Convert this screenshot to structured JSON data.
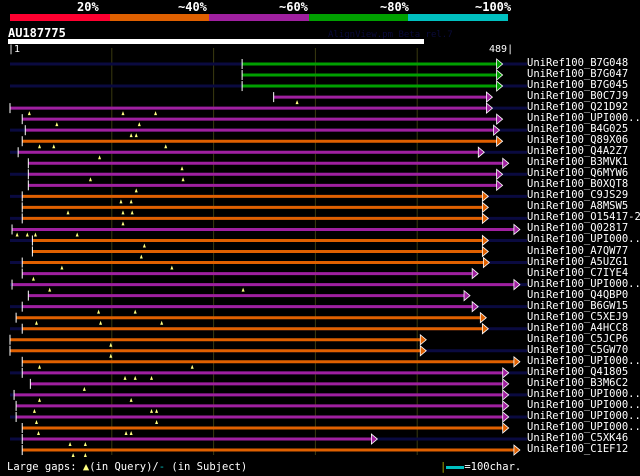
{
  "legend": {
    "labels": [
      "20%",
      "~40%",
      "~60%",
      "~80%",
      "~100%"
    ],
    "colors": [
      "#ff0030",
      "#e06000",
      "#a020a0",
      "#00a000",
      "#00c0c0"
    ]
  },
  "query": {
    "name": "AU187775",
    "start": "1",
    "end": "489",
    "length": 489
  },
  "credit": "AlignView.pm Beta rel.7",
  "hits": [
    {
      "name": "UniRef100_B7G048",
      "c": 3,
      "s": 229,
      "e": 479,
      "g": []
    },
    {
      "name": "UniRef100_B7G047",
      "c": 3,
      "s": 229,
      "e": 479,
      "g": []
    },
    {
      "name": "UniRef100_B7G045",
      "c": 3,
      "s": 229,
      "e": 479,
      "g": []
    },
    {
      "name": "UniRef100_B0C7J9",
      "c": 2,
      "s": 260,
      "e": 469,
      "g": [
        283
      ]
    },
    {
      "name": "UniRef100_Q21D92",
      "c": 2,
      "s": 1,
      "e": 469,
      "g": [
        20,
        112,
        144
      ]
    },
    {
      "name": "UniRef100_UPI000..",
      "c": 2,
      "s": 13,
      "e": 479,
      "g": [
        47,
        128
      ]
    },
    {
      "name": "UniRef100_B4G025",
      "c": 2,
      "s": 16,
      "e": 476,
      "g": [
        120,
        125
      ]
    },
    {
      "name": "UniRef100_Q89X06",
      "c": 1,
      "s": 13,
      "e": 479,
      "g": [
        30,
        44,
        154
      ]
    },
    {
      "name": "UniRef100_Q4A2Z7",
      "c": 2,
      "s": 9,
      "e": 461,
      "g": [
        89
      ]
    },
    {
      "name": "UniRef100_B3MVK1",
      "c": 2,
      "s": 19,
      "e": 485,
      "g": [
        170
      ]
    },
    {
      "name": "UniRef100_Q6MYW6",
      "c": 2,
      "s": 19,
      "e": 479,
      "g": [
        80,
        171
      ]
    },
    {
      "name": "UniRef100_B0XQT8",
      "c": 2,
      "s": 19,
      "e": 479,
      "g": [
        125
      ]
    },
    {
      "name": "UniRef100_C9JS29",
      "c": 1,
      "s": 13,
      "e": 465,
      "g": [
        110,
        120
      ]
    },
    {
      "name": "UniRef100_A8MSW5",
      "c": 1,
      "s": 13,
      "e": 465,
      "g": [
        58,
        112,
        121
      ]
    },
    {
      "name": "UniRef100_O15417-2",
      "c": 1,
      "s": 13,
      "e": 465,
      "g": [
        112
      ]
    },
    {
      "name": "UniRef100_Q02817",
      "c": 2,
      "s": 3,
      "e": 496,
      "g": [
        8,
        18,
        26,
        67
      ]
    },
    {
      "name": "UniRef100_UPI000..",
      "c": 1,
      "s": 23,
      "e": 465,
      "g": [
        133
      ]
    },
    {
      "name": "UniRef100_A7QW77",
      "c": 1,
      "s": 23,
      "e": 465,
      "g": [
        130
      ]
    },
    {
      "name": "UniRef100_A5UZG1",
      "c": 1,
      "s": 13,
      "e": 466,
      "g": [
        52,
        160
      ]
    },
    {
      "name": "UniRef100_C7IYE4",
      "c": 2,
      "s": 13,
      "e": 455,
      "g": [
        24
      ]
    },
    {
      "name": "UniRef100_UPI000..",
      "c": 2,
      "s": 3,
      "e": 496,
      "g": [
        40,
        230
      ]
    },
    {
      "name": "UniRef100_Q4QBP0",
      "c": 2,
      "s": 19,
      "e": 447,
      "g": []
    },
    {
      "name": "UniRef100_B6GW15",
      "c": 2,
      "s": 13,
      "e": 455,
      "g": [
        88,
        124
      ]
    },
    {
      "name": "UniRef100_C5XEJ9",
      "c": 1,
      "s": 7,
      "e": 463,
      "g": [
        27,
        90,
        150
      ]
    },
    {
      "name": "UniRef100_A4HCC8",
      "c": 1,
      "s": 13,
      "e": 465,
      "g": []
    },
    {
      "name": "UniRef100_C5JCP6",
      "c": 1,
      "s": 1,
      "e": 404,
      "g": [
        100
      ]
    },
    {
      "name": "UniRef100_C5GW70",
      "c": 1,
      "s": 1,
      "e": 404,
      "g": [
        100
      ]
    },
    {
      "name": "UniRef100_UPI000..",
      "c": 1,
      "s": 13,
      "e": 496,
      "g": [
        30,
        180
      ]
    },
    {
      "name": "UniRef100_Q41805",
      "c": 2,
      "s": 13,
      "e": 485,
      "g": [
        114,
        124,
        140
      ]
    },
    {
      "name": "UniRef100_B3M6C2",
      "c": 2,
      "s": 21,
      "e": 485,
      "g": [
        74
      ]
    },
    {
      "name": "UniRef100_UPI000..",
      "c": 2,
      "s": 5,
      "e": 485,
      "g": [
        30,
        120
      ]
    },
    {
      "name": "UniRef100_UPI000..",
      "c": 2,
      "s": 7,
      "e": 485,
      "g": [
        25,
        140,
        145
      ]
    },
    {
      "name": "UniRef100_UPI000..",
      "c": 2,
      "s": 7,
      "e": 485,
      "g": [
        27,
        145
      ]
    },
    {
      "name": "UniRef100_UPI000..",
      "c": 1,
      "s": 13,
      "e": 485,
      "g": [
        29,
        115,
        120
      ]
    },
    {
      "name": "UniRef100_C5XK46",
      "c": 2,
      "s": 13,
      "e": 356,
      "g": [
        60,
        75
      ]
    },
    {
      "name": "UniRef100_C1EF12",
      "c": 1,
      "s": 13,
      "e": 496,
      "g": [
        63,
        75
      ]
    }
  ],
  "footer": {
    "prefix": "Large gaps:",
    "query_text": "(in Query)/",
    "subject_mark": "-",
    "subject_text": " (in Subject)"
  },
  "scale": {
    "label": "=100char."
  }
}
